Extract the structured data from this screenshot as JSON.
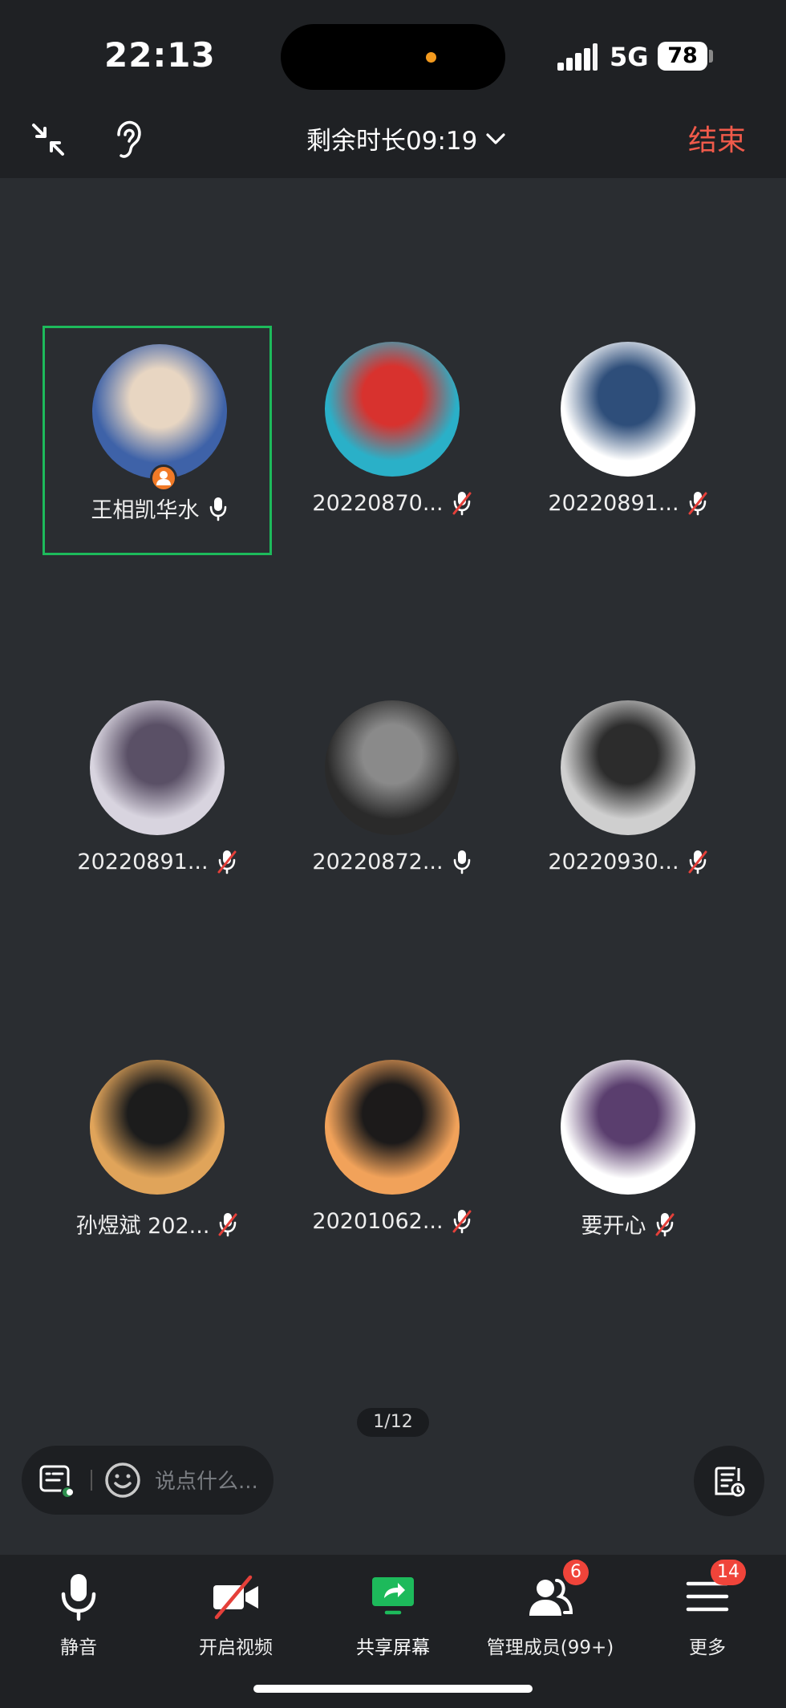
{
  "status_bar": {
    "time": "22:13",
    "network": "5G",
    "battery": "78",
    "island_dot_color": "#f39a1e"
  },
  "top_bar": {
    "collapse_icon": "collapse-arrows-icon",
    "ear_icon": "ear-icon",
    "timer_label": "剩余时长09:19",
    "end_label": "结束",
    "end_color": "#f05a4a"
  },
  "participants": [
    {
      "name": "王相凯华水",
      "mic": "on",
      "host": true,
      "speaking": true,
      "avatar_colors": [
        "#3e62a8",
        "#e8d6c2"
      ]
    },
    {
      "name": "20220870...",
      "mic": "muted",
      "host": false,
      "speaking": false,
      "avatar_colors": [
        "#2ab0c8",
        "#d8322e"
      ]
    },
    {
      "name": "20220891...",
      "mic": "muted",
      "host": false,
      "speaking": false,
      "avatar_colors": [
        "#ffffff",
        "#2e4e7a"
      ]
    },
    {
      "name": "20220891...",
      "mic": "muted",
      "host": false,
      "speaking": false,
      "avatar_colors": [
        "#d8d4df",
        "#5a5066"
      ]
    },
    {
      "name": "20220872...",
      "mic": "on",
      "host": false,
      "speaking": false,
      "avatar_colors": [
        "#2a2a2a",
        "#8a8a8a"
      ]
    },
    {
      "name": "20220930...",
      "mic": "muted",
      "host": false,
      "speaking": false,
      "avatar_colors": [
        "#cfcfcf",
        "#2c2c2c"
      ]
    },
    {
      "name": "孙煜斌 202...",
      "mic": "muted",
      "host": false,
      "speaking": false,
      "avatar_colors": [
        "#e0a45a",
        "#1c1c1c"
      ]
    },
    {
      "name": "20201062...",
      "mic": "muted",
      "host": false,
      "speaking": false,
      "avatar_colors": [
        "#f1a25a",
        "#1c1a1a"
      ]
    },
    {
      "name": "要开心",
      "mic": "muted",
      "host": false,
      "speaking": false,
      "avatar_colors": [
        "#ffffff",
        "#5a3e6e"
      ]
    }
  ],
  "page_indicator": "1/12",
  "chat": {
    "placeholder": "说点什么..."
  },
  "toolbar": {
    "items": [
      {
        "label": "静音",
        "icon": "microphone-icon"
      },
      {
        "label": "开启视频",
        "icon": "video-off-icon"
      },
      {
        "label": "共享屏幕",
        "icon": "share-screen-icon",
        "color": "#1dba5b"
      },
      {
        "label": "管理成员(99+)",
        "icon": "members-icon",
        "badge": "6"
      },
      {
        "label": "更多",
        "icon": "menu-icon",
        "badge": "14"
      }
    ]
  }
}
